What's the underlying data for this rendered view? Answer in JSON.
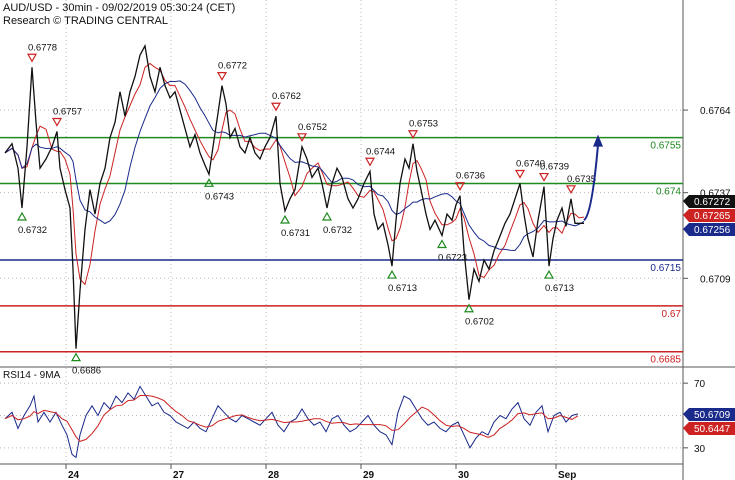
{
  "header": {
    "title": "AUD/USD - 30min - 09/02/2019 05:30:24 (CET)",
    "subtitle": "Research © TRADING CENTRAL"
  },
  "chart_data": [
    {
      "type": "line",
      "panel": "price",
      "y_ticks": [
        "0.6764",
        "0.6737",
        "0.6709"
      ],
      "ylim": [
        0.668,
        0.68
      ],
      "x_ticks": [
        "24",
        "27",
        "28",
        "29",
        "30",
        "Sep"
      ],
      "grid": true,
      "colors": {
        "price": "#111111",
        "ma_fast": "#cc2222",
        "ma_slow": "#1a2a8a",
        "support": "#1a2a8a",
        "resist": "#1f8a1f",
        "red_level": "#cc2222",
        "arrow": "#1a2a8a"
      },
      "horizontal_levels": [
        {
          "value": 0.6755,
          "label": "0.6755",
          "color": "green"
        },
        {
          "value": 0.674,
          "label": "0.674",
          "color": "green"
        },
        {
          "value": 0.6715,
          "label": "0.6715",
          "color": "blue"
        },
        {
          "value": 0.67,
          "label": "0.67",
          "color": "red"
        },
        {
          "value": 0.6685,
          "label": "0.6685",
          "color": "red"
        }
      ],
      "price_badges": [
        {
          "value": 0.67272,
          "label": "0.67272",
          "bg": "#111111"
        },
        {
          "value": 0.67265,
          "label": "0.67265",
          "bg": "#cc2222"
        },
        {
          "value": 0.67256,
          "label": "0.67256",
          "bg": "#1a2a8a"
        }
      ],
      "pivots": [
        {
          "t": 22,
          "value": 0.6732,
          "label": "0.6732",
          "kind": "low"
        },
        {
          "t": 32,
          "value": 0.6778,
          "label": "0.6778",
          "kind": "high"
        },
        {
          "t": 57,
          "value": 0.6757,
          "label": "0.6757",
          "kind": "high"
        },
        {
          "t": 76,
          "value": 0.6686,
          "label": "0.6686",
          "kind": "low"
        },
        {
          "t": 209,
          "value": 0.6743,
          "label": "0.6743",
          "kind": "low"
        },
        {
          "t": 222,
          "value": 0.6772,
          "label": "0.6772",
          "kind": "high"
        },
        {
          "t": 276,
          "value": 0.6762,
          "label": "0.6762",
          "kind": "high"
        },
        {
          "t": 285,
          "value": 0.6731,
          "label": "0.6731",
          "kind": "low"
        },
        {
          "t": 302,
          "value": 0.6752,
          "label": "0.6752",
          "kind": "high"
        },
        {
          "t": 327,
          "value": 0.6732,
          "label": "0.6732",
          "kind": "low"
        },
        {
          "t": 370,
          "value": 0.6744,
          "label": "0.6744",
          "kind": "high"
        },
        {
          "t": 392,
          "value": 0.6713,
          "label": "0.6713",
          "kind": "low"
        },
        {
          "t": 413,
          "value": 0.6753,
          "label": "0.6753",
          "kind": "high"
        },
        {
          "t": 442,
          "value": 0.6723,
          "label": "0.6723",
          "kind": "low"
        },
        {
          "t": 460,
          "value": 0.6736,
          "label": "0.6736",
          "kind": "high"
        },
        {
          "t": 469,
          "value": 0.6702,
          "label": "0.6702",
          "kind": "low"
        },
        {
          "t": 520,
          "value": 0.674,
          "label": "0.6740",
          "kind": "high"
        },
        {
          "t": 544,
          "value": 0.6739,
          "label": "0.6739",
          "kind": "high"
        },
        {
          "t": 549,
          "value": 0.6713,
          "label": "0.6713",
          "kind": "low"
        },
        {
          "t": 571,
          "value": 0.6735,
          "label": "0.6735",
          "kind": "high"
        }
      ],
      "price_path": [
        [
          5,
          0.675
        ],
        [
          12,
          0.6753
        ],
        [
          18,
          0.6745
        ],
        [
          22,
          0.6732
        ],
        [
          27,
          0.6752
        ],
        [
          32,
          0.6778
        ],
        [
          36,
          0.676
        ],
        [
          40,
          0.6745
        ],
        [
          46,
          0.6748
        ],
        [
          52,
          0.6752
        ],
        [
          57,
          0.6757
        ],
        [
          60,
          0.6745
        ],
        [
          65,
          0.6738
        ],
        [
          70,
          0.6732
        ],
        [
          73,
          0.6712
        ],
        [
          76,
          0.6686
        ],
        [
          80,
          0.6705
        ],
        [
          85,
          0.6725
        ],
        [
          90,
          0.6738
        ],
        [
          95,
          0.673
        ],
        [
          100,
          0.674
        ],
        [
          105,
          0.6745
        ],
        [
          110,
          0.6755
        ],
        [
          115,
          0.676
        ],
        [
          120,
          0.677
        ],
        [
          125,
          0.6762
        ],
        [
          130,
          0.677
        ],
        [
          135,
          0.6775
        ],
        [
          140,
          0.6782
        ],
        [
          145,
          0.6785
        ],
        [
          150,
          0.6775
        ],
        [
          155,
          0.677
        ],
        [
          160,
          0.6778
        ],
        [
          165,
          0.6772
        ],
        [
          170,
          0.6768
        ],
        [
          175,
          0.677
        ],
        [
          180,
          0.6764
        ],
        [
          185,
          0.6758
        ],
        [
          190,
          0.6752
        ],
        [
          195,
          0.6756
        ],
        [
          200,
          0.675
        ],
        [
          205,
          0.6746
        ],
        [
          209,
          0.6743
        ],
        [
          213,
          0.6752
        ],
        [
          218,
          0.6763
        ],
        [
          222,
          0.6772
        ],
        [
          226,
          0.6766
        ],
        [
          230,
          0.6755
        ],
        [
          235,
          0.6758
        ],
        [
          240,
          0.6752
        ],
        [
          245,
          0.675
        ],
        [
          250,
          0.6755
        ],
        [
          255,
          0.675
        ],
        [
          260,
          0.6748
        ],
        [
          265,
          0.6752
        ],
        [
          270,
          0.6755
        ],
        [
          276,
          0.6762
        ],
        [
          280,
          0.674
        ],
        [
          285,
          0.6731
        ],
        [
          290,
          0.6735
        ],
        [
          295,
          0.6738
        ],
        [
          302,
          0.6752
        ],
        [
          307,
          0.6748
        ],
        [
          312,
          0.6742
        ],
        [
          318,
          0.6745
        ],
        [
          322,
          0.674
        ],
        [
          327,
          0.6732
        ],
        [
          332,
          0.674
        ],
        [
          337,
          0.6745
        ],
        [
          342,
          0.6742
        ],
        [
          348,
          0.6735
        ],
        [
          353,
          0.6732
        ],
        [
          358,
          0.6735
        ],
        [
          364,
          0.674
        ],
        [
          370,
          0.6744
        ],
        [
          374,
          0.673
        ],
        [
          378,
          0.6725
        ],
        [
          383,
          0.6727
        ],
        [
          388,
          0.672
        ],
        [
          392,
          0.6713
        ],
        [
          396,
          0.6728
        ],
        [
          400,
          0.674
        ],
        [
          405,
          0.6748
        ],
        [
          409,
          0.6745
        ],
        [
          413,
          0.6753
        ],
        [
          417,
          0.6744
        ],
        [
          421,
          0.6738
        ],
        [
          426,
          0.673
        ],
        [
          430,
          0.6725
        ],
        [
          435,
          0.6728
        ],
        [
          442,
          0.6723
        ],
        [
          447,
          0.673
        ],
        [
          452,
          0.6728
        ],
        [
          456,
          0.6733
        ],
        [
          460,
          0.6736
        ],
        [
          464,
          0.6718
        ],
        [
          469,
          0.6702
        ],
        [
          474,
          0.6712
        ],
        [
          479,
          0.6708
        ],
        [
          484,
          0.6715
        ],
        [
          489,
          0.6712
        ],
        [
          494,
          0.6718
        ],
        [
          499,
          0.6722
        ],
        [
          505,
          0.6727
        ],
        [
          510,
          0.673
        ],
        [
          515,
          0.6735
        ],
        [
          520,
          0.674
        ],
        [
          524,
          0.673
        ],
        [
          528,
          0.6722
        ],
        [
          533,
          0.6716
        ],
        [
          538,
          0.6728
        ],
        [
          544,
          0.6739
        ],
        [
          549,
          0.6713
        ],
        [
          553,
          0.6722
        ],
        [
          557,
          0.6728
        ],
        [
          562,
          0.6732
        ],
        [
          566,
          0.6726
        ],
        [
          571,
          0.6735
        ],
        [
          575,
          0.6727
        ],
        [
          579,
          0.6727
        ],
        [
          584,
          0.6727
        ]
      ],
      "forecast_arrow": {
        "from_t": 584,
        "from_value": 0.6728,
        "to_t": 598,
        "to_value": 0.6756
      }
    },
    {
      "type": "line",
      "panel": "rsi",
      "title": "RSI14 - 9MA",
      "y_ticks": [
        "70",
        "30"
      ],
      "ylim": [
        20,
        80
      ],
      "badges": [
        {
          "value": 50.6709,
          "label": "50.6709",
          "bg": "#1a2a8a"
        },
        {
          "value": 50.6447,
          "label": "50.6447",
          "bg": "#cc2222"
        }
      ],
      "rsi_path": [
        [
          5,
          48
        ],
        [
          12,
          52
        ],
        [
          18,
          42
        ],
        [
          24,
          50
        ],
        [
          30,
          56
        ],
        [
          34,
          62
        ],
        [
          38,
          46
        ],
        [
          44,
          52
        ],
        [
          50,
          46
        ],
        [
          56,
          52
        ],
        [
          62,
          44
        ],
        [
          67,
          38
        ],
        [
          72,
          26
        ],
        [
          76,
          24
        ],
        [
          80,
          38
        ],
        [
          86,
          50
        ],
        [
          92,
          56
        ],
        [
          98,
          50
        ],
        [
          104,
          58
        ],
        [
          110,
          54
        ],
        [
          116,
          62
        ],
        [
          122,
          58
        ],
        [
          128,
          64
        ],
        [
          134,
          60
        ],
        [
          140,
          68
        ],
        [
          146,
          62
        ],
        [
          152,
          56
        ],
        [
          158,
          58
        ],
        [
          164,
          52
        ],
        [
          170,
          50
        ],
        [
          176,
          46
        ],
        [
          182,
          44
        ],
        [
          188,
          42
        ],
        [
          194,
          46
        ],
        [
          200,
          42
        ],
        [
          206,
          40
        ],
        [
          212,
          48
        ],
        [
          218,
          56
        ],
        [
          224,
          52
        ],
        [
          230,
          48
        ],
        [
          236,
          46
        ],
        [
          242,
          50
        ],
        [
          248,
          48
        ],
        [
          254,
          46
        ],
        [
          260,
          44
        ],
        [
          266,
          48
        ],
        [
          272,
          52
        ],
        [
          278,
          44
        ],
        [
          284,
          40
        ],
        [
          290,
          46
        ],
        [
          296,
          48
        ],
        [
          302,
          54
        ],
        [
          308,
          48
        ],
        [
          314,
          44
        ],
        [
          320,
          46
        ],
        [
          326,
          40
        ],
        [
          332,
          48
        ],
        [
          338,
          50
        ],
        [
          344,
          44
        ],
        [
          350,
          40
        ],
        [
          356,
          42
        ],
        [
          362,
          46
        ],
        [
          368,
          50
        ],
        [
          374,
          44
        ],
        [
          380,
          40
        ],
        [
          386,
          38
        ],
        [
          392,
          32
        ],
        [
          398,
          52
        ],
        [
          404,
          62
        ],
        [
          410,
          60
        ],
        [
          416,
          54
        ],
        [
          422,
          48
        ],
        [
          428,
          44
        ],
        [
          434,
          46
        ],
        [
          440,
          42
        ],
        [
          446,
          40
        ],
        [
          452,
          44
        ],
        [
          458,
          46
        ],
        [
          464,
          38
        ],
        [
          470,
          30
        ],
        [
          476,
          36
        ],
        [
          482,
          40
        ],
        [
          488,
          38
        ],
        [
          494,
          46
        ],
        [
          500,
          50
        ],
        [
          506,
          48
        ],
        [
          512,
          54
        ],
        [
          518,
          58
        ],
        [
          524,
          48
        ],
        [
          530,
          44
        ],
        [
          536,
          52
        ],
        [
          542,
          56
        ],
        [
          548,
          40
        ],
        [
          554,
          50
        ],
        [
          560,
          52
        ],
        [
          566,
          46
        ],
        [
          572,
          50
        ],
        [
          578,
          51
        ]
      ]
    }
  ]
}
